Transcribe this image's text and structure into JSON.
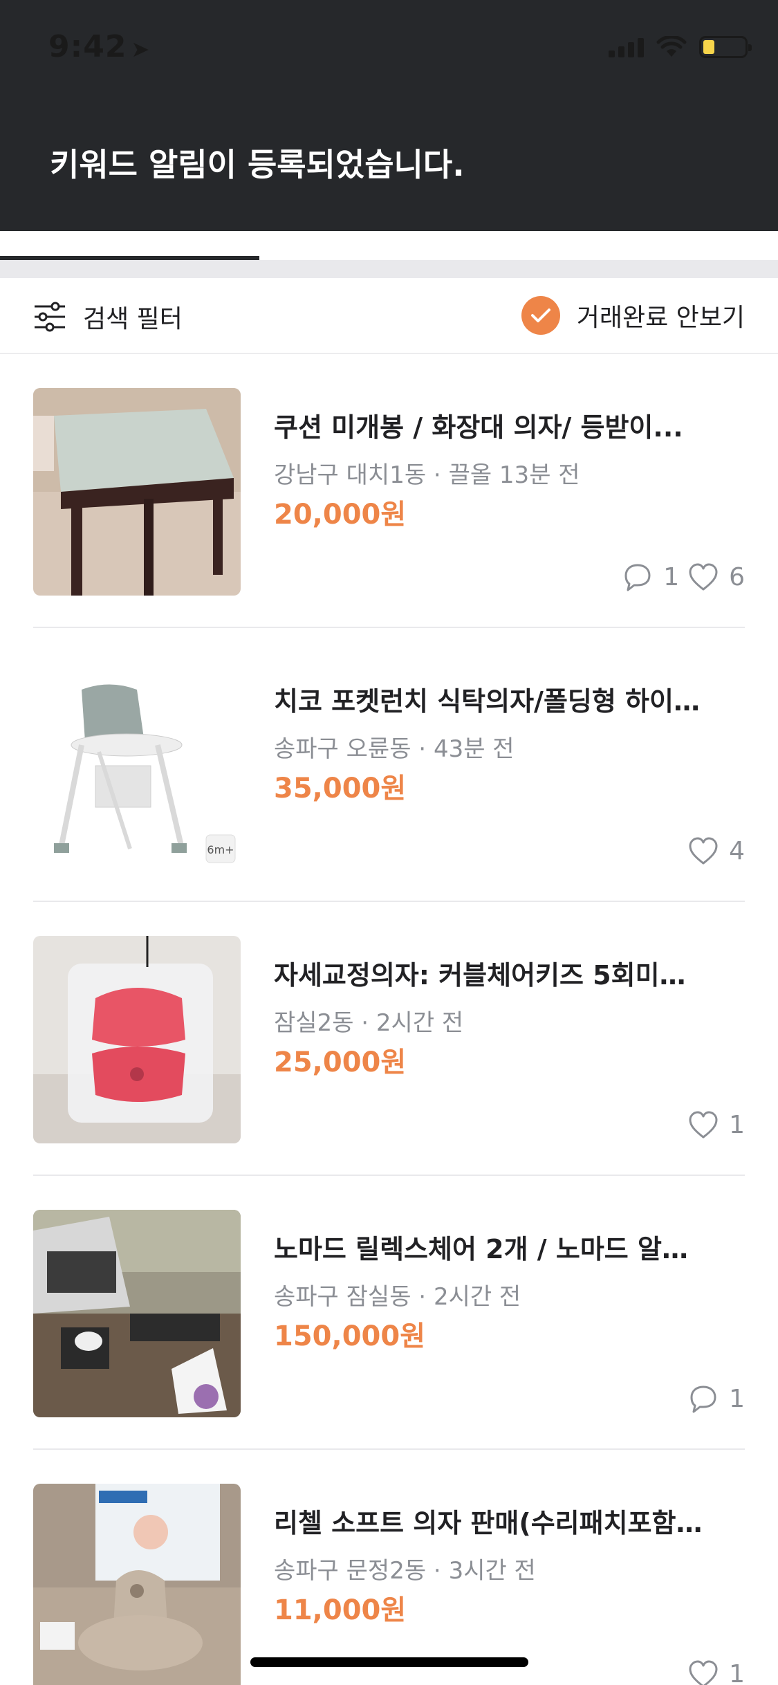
{
  "status_bar": {
    "time": "9:42",
    "battery_color": "#f7d54b"
  },
  "toast": {
    "message": "키워드 알림이 등록되었습니다."
  },
  "filter": {
    "label": "검색 필터",
    "hide_completed_label": "거래완료 안보기",
    "accent": "#ee8548"
  },
  "items": [
    {
      "title": "쿠션 미개봉 / 화장대 의자/ 등받이...",
      "location": "강남구 대치1동",
      "time": "끌올 13분 전",
      "price": "20,000원",
      "chats": "1",
      "likes": "6",
      "image": "stool"
    },
    {
      "title": "치코 포켓런치 식탁의자/폴딩형 하이…",
      "location": "송파구 오륜동",
      "time": "43분 전",
      "price": "35,000원",
      "chats": "",
      "likes": "4",
      "image": "high-chair",
      "badge": "6m+"
    },
    {
      "title": "자세교정의자: 커블체어키즈 5회미…",
      "location": "잠실2동",
      "time": "2시간 전",
      "price": "25,000원",
      "chats": "",
      "likes": "1",
      "image": "posture-seat"
    },
    {
      "title": "노마드 릴렉스체어 2개 / 노마드 알…",
      "location": "송파구 잠실동",
      "time": "2시간 전",
      "price": "150,000원",
      "chats": "1",
      "likes": "",
      "image": "camping"
    },
    {
      "title": "리첼 소프트 의자 판매(수리패치포함…",
      "location": "송파구 문정2동",
      "time": "3시간 전",
      "price": "11,000원",
      "chats": "",
      "likes": "1",
      "image": "baby-seat"
    }
  ]
}
